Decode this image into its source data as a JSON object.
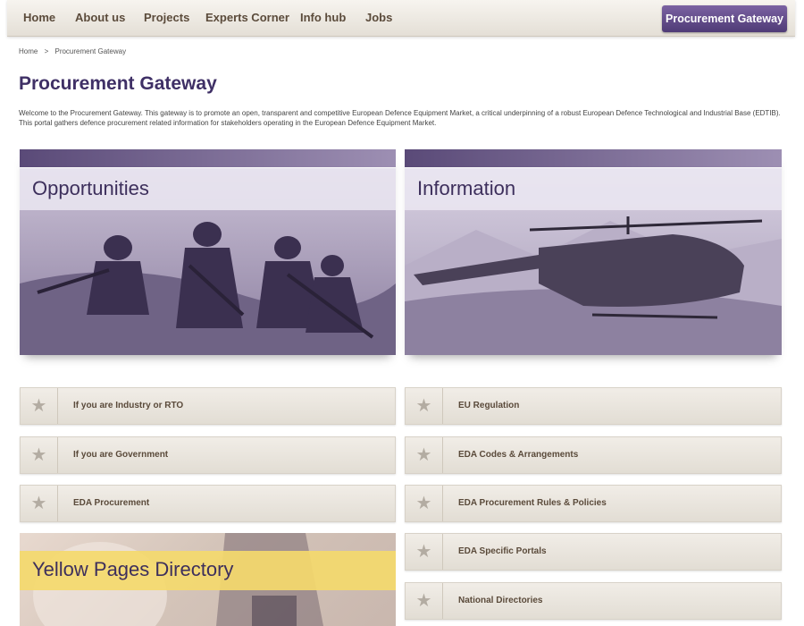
{
  "nav": {
    "items": [
      "Home",
      "About us",
      "Projects",
      "Experts Corner",
      "Info hub",
      "Jobs"
    ],
    "gateway_button": "Procurement Gateway"
  },
  "breadcrumb": [
    "Home",
    ">",
    "Procurement Gateway"
  ],
  "page": {
    "title": "Procurement Gateway",
    "intro": "Welcome to the Procurement Gateway. This gateway is to promote an open, transparent and competitive European Defence Equipment Market, a critical underpinning of a robust European Defence Technological and Industrial Base (EDTIB). This portal gathers defence procurement related information for stakeholders operating in the European Defence Equipment Market."
  },
  "panels": {
    "opportunities": "Opportunities",
    "information": "Information"
  },
  "left_links": [
    "If you are Industry or RTO",
    "If you are Government",
    "EDA Procurement"
  ],
  "right_links": [
    "EU Regulation",
    "EDA Codes & Arrangements",
    "EDA Procurement Rules & Policies",
    "EDA Specific Portals",
    "National Directories"
  ],
  "yellow_pages": "Yellow Pages Directory",
  "colors": {
    "accent": "#4f3b76",
    "title": "#3f3066",
    "yellow": "#f4d96c"
  }
}
